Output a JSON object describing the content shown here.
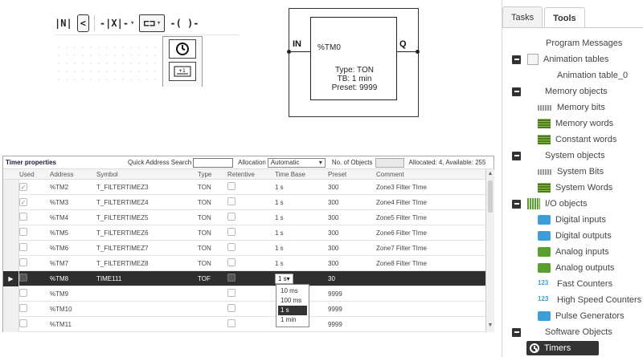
{
  "function_block": {
    "input_label": "IN",
    "output_label": "Q",
    "name": "%TM0",
    "type_line": "Type: TON",
    "tb_line": "TB: 1 min",
    "preset_line": "Preset: 9999"
  },
  "timer_properties": {
    "title": "Timer properties",
    "search_label": "Quick Address Search",
    "search_value": "",
    "allocation_label": "Allocation",
    "allocation_value": "Automatic",
    "objects_label": "No. of Objects",
    "objects_value": "",
    "stats": "Allocated: 4, Available: 255",
    "columns": [
      "Used",
      "Address",
      "Symbol",
      "Type",
      "Retentive",
      "Time Base",
      "Preset",
      "Comment"
    ],
    "rows": [
      {
        "used": true,
        "address": "%TM2",
        "symbol": "T_FILTERTIMEZ3",
        "type": "TON",
        "timebase": "1 s",
        "preset": "300",
        "comment": "Zone3 Filter TIme"
      },
      {
        "used": true,
        "address": "%TM3",
        "symbol": "T_FILTERTIMEZ4",
        "type": "TON",
        "timebase": "1 s",
        "preset": "300",
        "comment": "Zone4 Filter TIme"
      },
      {
        "used": false,
        "address": "%TM4",
        "symbol": "T_FILTERTIMEZ5",
        "type": "TON",
        "timebase": "1 s",
        "preset": "300",
        "comment": "Zone5 Filter TIme"
      },
      {
        "used": false,
        "address": "%TM5",
        "symbol": "T_FILTERTIMEZ6",
        "type": "TON",
        "timebase": "1 s",
        "preset": "300",
        "comment": "Zone6 Filter TIme"
      },
      {
        "used": false,
        "address": "%TM6",
        "symbol": "T_FILTERTIMEZ7",
        "type": "TON",
        "timebase": "1 s",
        "preset": "300",
        "comment": "Zone7 Filter TIme"
      },
      {
        "used": false,
        "address": "%TM7",
        "symbol": "T_FILTERTIMEZ8",
        "type": "TON",
        "timebase": "1 s",
        "preset": "300",
        "comment": "Zone8 Filter TIme"
      },
      {
        "used": false,
        "address": "%TM8",
        "symbol": "TIME111",
        "type": "TOF",
        "timebase": "1 s",
        "preset": "30",
        "comment": "",
        "selected": true
      },
      {
        "used": false,
        "address": "%TM9",
        "symbol": "",
        "type": "",
        "timebase": "",
        "preset": "9999",
        "comment": ""
      },
      {
        "used": false,
        "address": "%TM10",
        "symbol": "",
        "type": "",
        "timebase": "",
        "preset": "9999",
        "comment": ""
      },
      {
        "used": false,
        "address": "%TM11",
        "symbol": "",
        "type": "",
        "timebase": "",
        "preset": "9999",
        "comment": ""
      }
    ],
    "timebase_options": [
      "10 ms",
      "100 ms",
      "1 s",
      "1 min"
    ],
    "timebase_selected": "1 s"
  },
  "tools_panel": {
    "tabs": [
      "Tasks",
      "Tools"
    ],
    "active_tab": "Tools",
    "tree": {
      "program_messages": "Program Messages",
      "animation_tables": "Animation tables",
      "animation_table_0": "Animation table_0",
      "memory_objects": "Memory objects",
      "memory_bits": "Memory bits",
      "memory_words": "Memory words",
      "constant_words": "Constant words",
      "system_objects": "System objects",
      "system_bits": "System Bits",
      "system_words": "System Words",
      "io_objects": "I/O objects",
      "digital_inputs": "Digital inputs",
      "digital_outputs": "Digital outputs",
      "analog_inputs": "Analog inputs",
      "analog_outputs": "Analog outputs",
      "fast_counters": "Fast Counters",
      "high_speed_counters": "High Speed Counters",
      "pulse_generators": "Pulse Generators",
      "software_objects": "Software Objects",
      "timers": "Timers"
    }
  }
}
